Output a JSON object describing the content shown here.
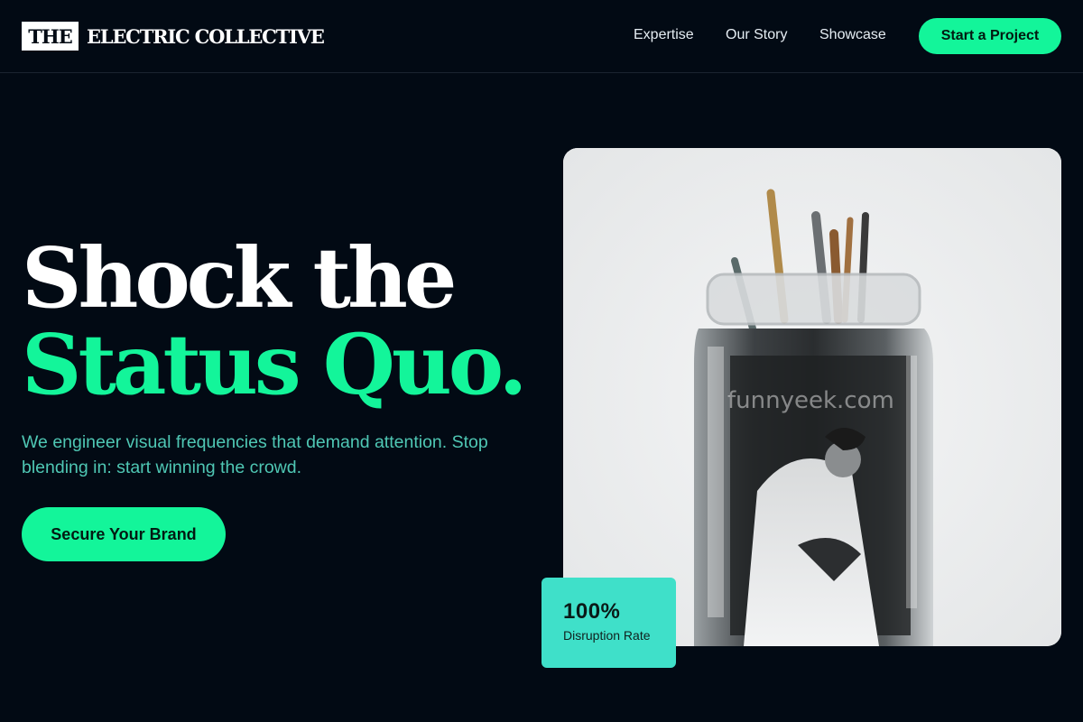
{
  "header": {
    "logo_box": "THE",
    "logo_text": "ELECTRIC COLLECTIVE",
    "nav": [
      "Expertise",
      "Our Story",
      "Showcase"
    ],
    "cta": "Start a Project"
  },
  "hero": {
    "title_line1": "Shock the",
    "title_line2": "Status Quo.",
    "subtitle": "We engineer visual frequencies that demand attention. Stop blending in: start winning the crowd.",
    "cta": "Secure Your Brand"
  },
  "image": {
    "watermark": "funnyeek.com"
  },
  "stat": {
    "value": "100%",
    "label": "Disruption Rate"
  },
  "colors": {
    "background": "#020a14",
    "accent": "#13f59a",
    "subtitle": "#4fc7b4",
    "stat_card": "#3fe0c9"
  }
}
